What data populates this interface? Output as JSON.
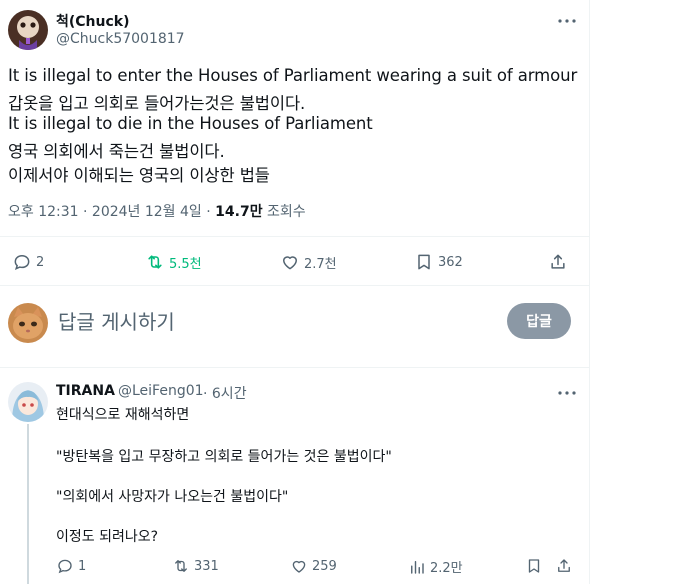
{
  "tweet": {
    "author_name": "척(Chuck)",
    "author_handle": "@Chuck57001817",
    "lines": [
      "It is illegal to enter the Houses of Parliament wearing a suit of armour",
      "갑옷을 입고 의회로 들어가는것은 불법이다.",
      "It is illegal to die in the Houses of Parliament",
      "영국 의회에서 죽는건 불법이다.",
      "이제서야 이해되는 영국의 이상한 법들"
    ],
    "timestamp": "오후 12:31 · 2024년 12월 4일 · ",
    "views_count": "14.7만",
    "views_label": " 조회수",
    "stats": {
      "replies": "2",
      "retweets": "5.5천",
      "likes": "2.7천",
      "bookmarks": "362"
    },
    "accent_retweet": "#00ba7c"
  },
  "compose": {
    "placeholder": "답글 게시하기",
    "button_label": "답글"
  },
  "reply": {
    "author_name": "TIRANA",
    "author_handle": "@LeiFeng01",
    "time": "· 6시간",
    "lines": [
      "현대식으로 재해석하면",
      "\"방탄복을 입고 무장하고 의회로 들어가는 것은 불법이다\"",
      "\"의회에서 사망자가 나오는건 불법이다\"",
      "이정도 되려나오?"
    ],
    "stats": {
      "replies": "1",
      "retweets": "331",
      "likes": "259",
      "views": "2.2만"
    }
  },
  "icons": [
    "more-icon",
    "reply-icon",
    "retweet-icon",
    "like-icon",
    "bookmark-icon",
    "share-icon",
    "views-icon"
  ]
}
